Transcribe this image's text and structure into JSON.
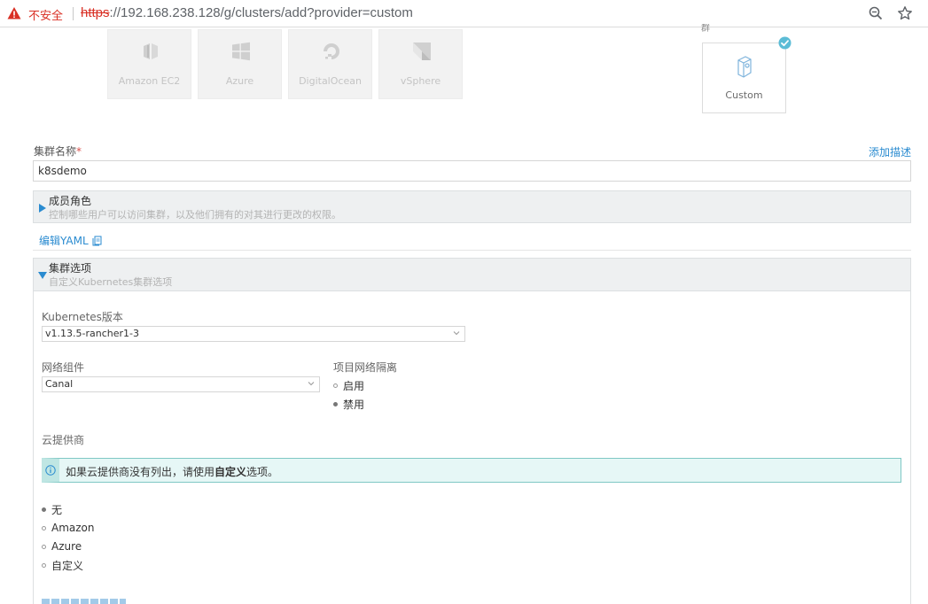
{
  "browser": {
    "security_label": "不安全",
    "url_scheme": "https",
    "url_rest": "://192.168.238.128/g/clusters/add?provider=custom"
  },
  "providers": {
    "tiles": [
      {
        "label": "Amazon EC2",
        "icon": "amazon-ec2-icon"
      },
      {
        "label": "Azure",
        "icon": "azure-windows-icon"
      },
      {
        "label": "DigitalOcean",
        "icon": "digitalocean-icon"
      },
      {
        "label": "vSphere",
        "icon": "vsphere-icon"
      }
    ],
    "group_label_cut": "群",
    "custom": {
      "label": "Custom",
      "icon": "custom-node-icon",
      "selected": true
    }
  },
  "cluster_name": {
    "label": "集群名称",
    "required_mark": "*",
    "value": "k8sdemo",
    "add_description": "添加描述"
  },
  "members": {
    "title": "成员角色",
    "subtitle": "控制哪些用户可以访问集群，以及他们拥有的对其进行更改的权限。"
  },
  "edit_yaml": "编辑YAML",
  "cluster_options": {
    "title": "集群选项",
    "subtitle": "自定义Kubernetes集群选项",
    "k8s_version": {
      "label": "Kubernetes版本",
      "value": "v1.13.5-rancher1-3"
    },
    "network": {
      "label": "网络组件",
      "value": "Canal"
    },
    "isolation": {
      "label": "项目网络隔离",
      "options": [
        {
          "label": "启用",
          "selected": false
        },
        {
          "label": "禁用",
          "selected": true
        }
      ]
    },
    "cloud_provider": {
      "label": "云提供商",
      "info_prefix": "如果云提供商没有列出，请使用",
      "info_bold": "自定义",
      "info_suffix": "选项。",
      "options": [
        {
          "label": "无",
          "selected": true
        },
        {
          "label": "Amazon",
          "selected": false
        },
        {
          "label": "Azure",
          "selected": false
        },
        {
          "label": "自定义",
          "selected": false
        }
      ]
    }
  },
  "colors": {
    "accent": "#2a8bd0",
    "danger": "#d93025",
    "info_border": "#7fc8c4",
    "check": "#5bbcd6"
  }
}
